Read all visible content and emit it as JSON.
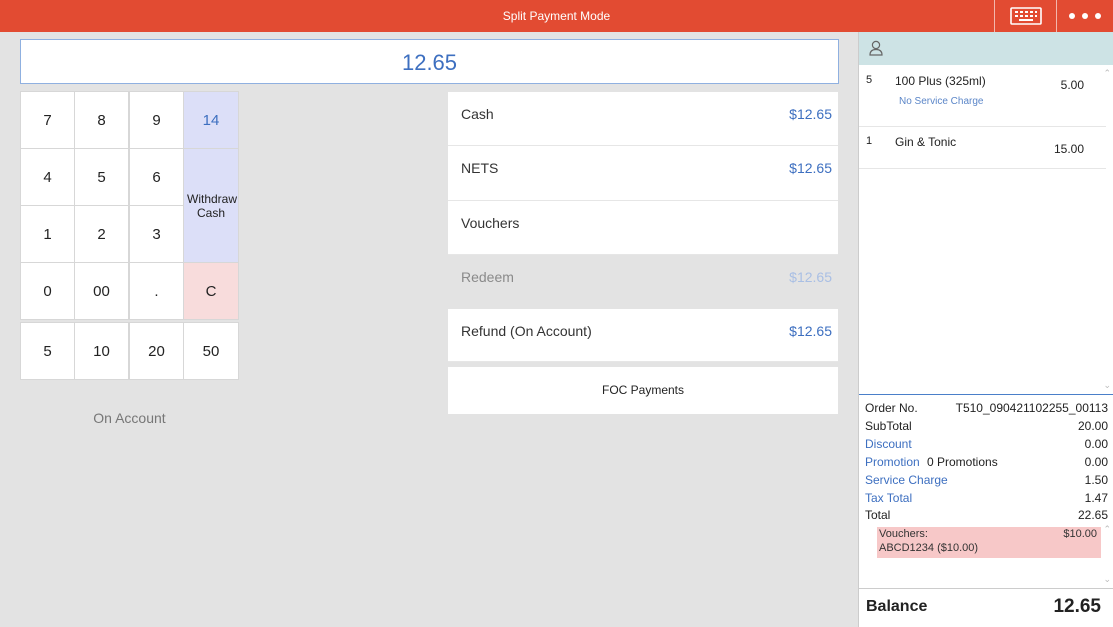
{
  "header": {
    "title": "Split Payment Mode",
    "keyboard_icon": "keyboard-icon",
    "more_icon": "more-horizontal-icon"
  },
  "amount_display": "12.65",
  "keypad": {
    "keys": [
      "7",
      "8",
      "9",
      "14",
      "4",
      "5",
      "6",
      "Withdraw Cash",
      "1",
      "2",
      "3",
      "0",
      "00",
      ".",
      "C",
      "5",
      "10",
      "20",
      "50"
    ]
  },
  "on_account": "On Account",
  "payments": [
    {
      "name": "Cash",
      "amount": "$12.65"
    },
    {
      "name": "NETS",
      "amount": "$12.65"
    },
    {
      "name": "Vouchers",
      "amount": ""
    },
    {
      "name": "Redeem",
      "amount": "$12.65"
    },
    {
      "name": "Refund (On Account)",
      "amount": "$12.65"
    }
  ],
  "foc_label": "FOC Payments",
  "customer_icon": "user-icon",
  "order_items": [
    {
      "qty": "5",
      "name": "100 Plus (325ml)",
      "price": "5.00",
      "note": "No Service Charge"
    },
    {
      "qty": "1",
      "name": "Gin & Tonic",
      "price": "15.00",
      "note": ""
    }
  ],
  "summary": {
    "order_no_label": "Order No.",
    "order_no": "T510_090421102255_00113",
    "subtotal_label": "SubTotal",
    "subtotal": "20.00",
    "discount_label": "Discount",
    "discount": "0.00",
    "promotion_label": "Promotion",
    "promotion_count": "0 Promotions",
    "promotion": "0.00",
    "service_label": "Service Charge",
    "service": "1.50",
    "tax_label": "Tax Total",
    "tax": "1.47",
    "total_label": "Total",
    "total": "22.65"
  },
  "vouchers": {
    "label": "Vouchers:",
    "value": "$10.00",
    "code": "ABCD1234 ($10.00)"
  },
  "balance": {
    "label": "Balance",
    "value": "12.65"
  },
  "colors": {
    "header": "#e24b32",
    "accent_blue": "#3d6fc0",
    "keypad_blue": "#dcdff8",
    "keypad_pink": "#f8dcdc",
    "voucher_pink": "#f7c8c8",
    "customer_bar": "#cde3e5"
  }
}
